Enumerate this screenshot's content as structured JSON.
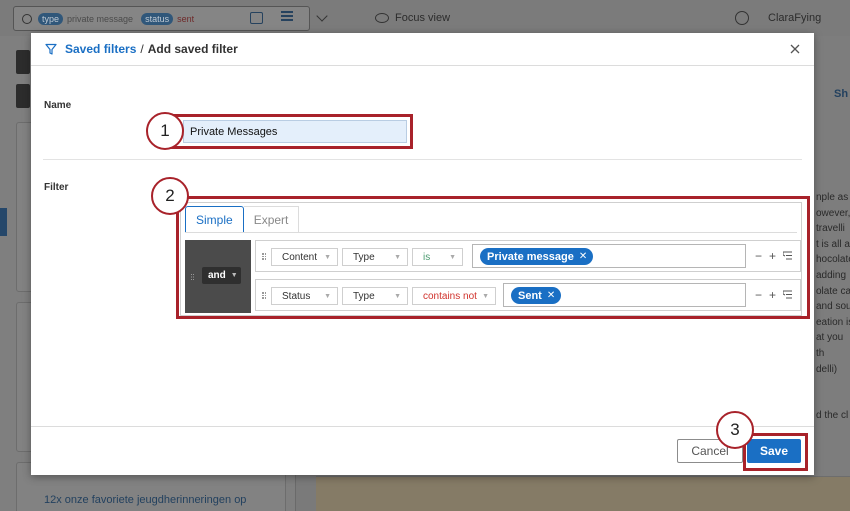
{
  "background": {
    "search_chips": [
      {
        "key": "type",
        "value": "private message"
      },
      {
        "key": "status",
        "value": "sent"
      }
    ],
    "focus_view_label": "Focus view",
    "username": "ClaraFying",
    "right_tab_label": "Sh",
    "right_snippets": [
      "nple as",
      "owever,",
      "travelli",
      "t is all a",
      "hocolate",
      "adding",
      "olate ca",
      "and sou",
      "eation is",
      "at you th",
      "delli)",
      "",
      "",
      "d the cl"
    ],
    "bottom_link": "12x onze favoriete jeugdherinneringen op"
  },
  "modal": {
    "breadcrumb_link": "Saved filters",
    "breadcrumb_sep": "/",
    "breadcrumb_current": "Add saved filter",
    "name_label": "Name",
    "name_value": "Private Messages",
    "filter_label": "Filter",
    "tabs": [
      "Simple",
      "Expert"
    ],
    "operator": "and",
    "rules": [
      {
        "field": "Content",
        "attribute": "Type",
        "condition": "is",
        "value": "Private message"
      },
      {
        "field": "Status",
        "attribute": "Type",
        "condition": "contains not",
        "value": "Sent"
      }
    ],
    "cancel_label": "Cancel",
    "save_label": "Save"
  },
  "annotations": [
    "1",
    "2",
    "3"
  ],
  "colors": {
    "accent": "#1a6fc4",
    "annotation": "#a8222a",
    "condition_is": "#4a9a6f",
    "condition_not": "#d0322c"
  }
}
